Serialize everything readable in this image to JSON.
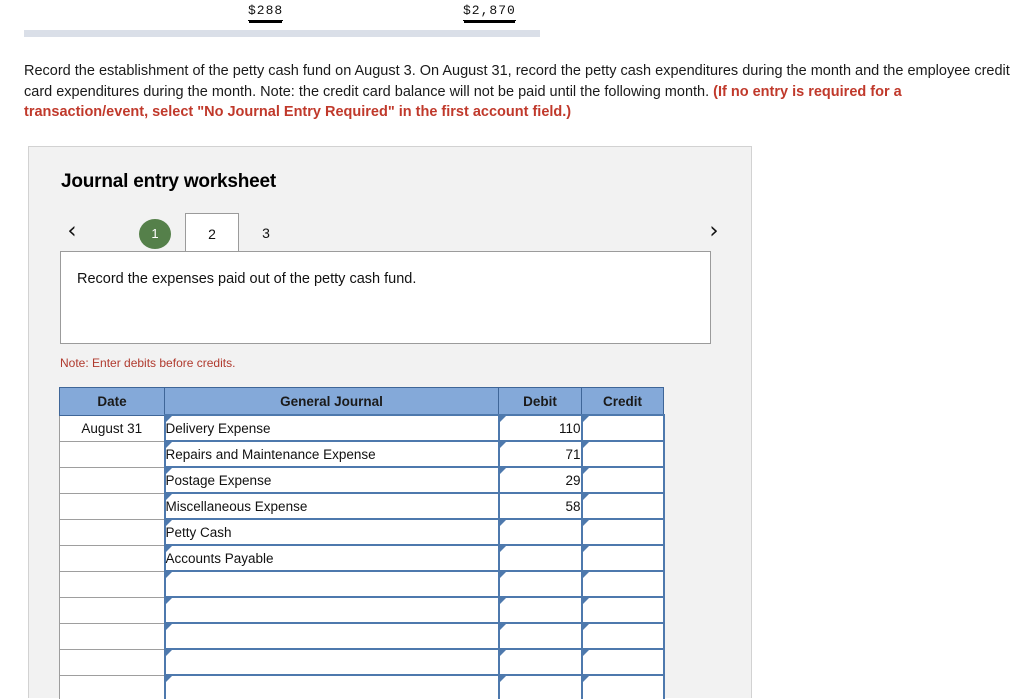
{
  "top_fragment": {
    "total_left": "$288",
    "total_right": "$2,870"
  },
  "instructions": {
    "body": "Record the establishment of the petty cash fund on August 3.  On August 31, record the petty cash expenditures during the month and the employee credit card expenditures during the month. Note: the credit card balance will not be paid until the following month. ",
    "red_note": "(If no entry is required for a transaction/event, select \"No Journal Entry Required\" in the first account field.)"
  },
  "worksheet": {
    "title": "Journal entry worksheet",
    "nav": {
      "prev_icon": "chevron-left-icon",
      "next_icon": "chevron-right-icon",
      "prev_glyph": "‹",
      "next_glyph": "›"
    },
    "tabs": [
      {
        "label": "1",
        "state": "completed"
      },
      {
        "label": "2",
        "state": "active"
      },
      {
        "label": "3",
        "state": "inactive"
      }
    ],
    "requirement": "Record the expenses paid out of the petty cash fund.",
    "note": "Note: Enter debits before credits.",
    "table": {
      "headers": [
        "Date",
        "General Journal",
        "Debit",
        "Credit"
      ],
      "rows": [
        {
          "date": "August 31",
          "account": "Delivery Expense",
          "debit": "110",
          "credit": "",
          "selected": ""
        },
        {
          "date": "",
          "account": "Repairs and Maintenance Expense",
          "debit": "71",
          "credit": "",
          "selected": ""
        },
        {
          "date": "",
          "account": "Postage Expense",
          "debit": "29",
          "credit": "",
          "selected": ""
        },
        {
          "date": "",
          "account": "Miscellaneous Expense",
          "debit": "58",
          "credit": "",
          "selected": "debit"
        },
        {
          "date": "",
          "account": "Petty Cash",
          "debit": "",
          "credit": "",
          "selected": ""
        },
        {
          "date": "",
          "account": "Accounts Payable",
          "debit": "",
          "credit": "",
          "selected": ""
        },
        {
          "date": "",
          "account": "",
          "debit": "",
          "credit": "",
          "selected": ""
        },
        {
          "date": "",
          "account": "",
          "debit": "",
          "credit": "",
          "selected": ""
        },
        {
          "date": "",
          "account": "",
          "debit": "",
          "credit": "",
          "selected": ""
        },
        {
          "date": "",
          "account": "",
          "debit": "",
          "credit": "",
          "selected": ""
        },
        {
          "date": "",
          "account": "",
          "debit": "",
          "credit": "",
          "selected": ""
        }
      ]
    }
  },
  "colors": {
    "tab_completed": "#55804a",
    "table_header": "#84a9d9",
    "cell_border": "#4e79ad",
    "red_note": "#c0392b",
    "panel_bg": "#f2f2f2",
    "band": "#dadfe8"
  }
}
